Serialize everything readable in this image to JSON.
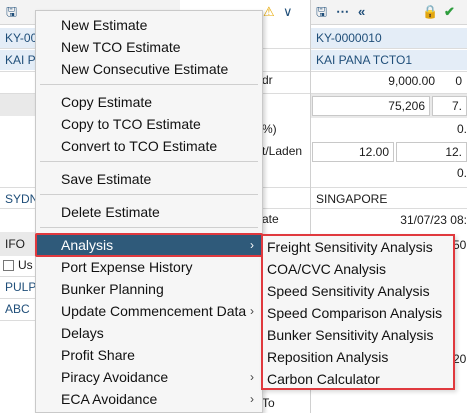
{
  "background": {
    "left_id": "KY-00",
    "left_name": "KAI P",
    "sydney": "SYDN",
    "ifo": "IFO",
    "us": "Us",
    "pulp": "PULP",
    "abc": "ABC",
    "right_id": "KY-0000010",
    "right_name": "KAI PANA TCTO1",
    "label_dr": "dr",
    "label_pct": "%)",
    "label_laden": "t/Laden",
    "label_ate": "ate",
    "label_to": "To",
    "val_9000": "9,000.00",
    "val_0a": "0",
    "val_75206": "75,206",
    "val_7": "7.",
    "val_0b": "0.",
    "val_0c": "0.",
    "val_1200": "12.00",
    "val_12": "12.",
    "port": "SINGAPORE",
    "date": "31/07/23 08:",
    "val_50": "50.",
    "val_20": "20."
  },
  "menu": {
    "items": [
      {
        "label": "New Estimate",
        "has_submenu": false
      },
      {
        "label": "New TCO Estimate",
        "has_submenu": false
      },
      {
        "label": "New Consecutive Estimate",
        "has_submenu": false
      },
      {
        "label": "Copy Estimate",
        "has_submenu": false
      },
      {
        "label": "Copy to TCO Estimate",
        "has_submenu": false
      },
      {
        "label": "Convert to TCO Estimate",
        "has_submenu": false
      },
      {
        "label": "Save Estimate",
        "has_submenu": false
      },
      {
        "label": "Delete Estimate",
        "has_submenu": false
      },
      {
        "label": "Analysis",
        "has_submenu": true,
        "active": true
      },
      {
        "label": "Port Expense History",
        "has_submenu": false
      },
      {
        "label": "Bunker Planning",
        "has_submenu": false
      },
      {
        "label": "Update Commencement Data",
        "has_submenu": true
      },
      {
        "label": "Delays",
        "has_submenu": false
      },
      {
        "label": "Profit Share",
        "has_submenu": false
      },
      {
        "label": "Piracy Avoidance",
        "has_submenu": true
      },
      {
        "label": "ECA Avoidance",
        "has_submenu": true
      }
    ],
    "arrow_glyph": "›"
  },
  "submenu": {
    "items": [
      "Freight Sensitivity Analysis",
      "COA/CVC Analysis",
      "Speed Sensitivity Analysis",
      "Speed Comparison Analysis",
      "Bunker Sensitivity Analysis",
      "Reposition Analysis",
      "Carbon Calculator"
    ]
  },
  "toolbar": {
    "icons": [
      "save-icon",
      "more-icon",
      "collapse-left-icon",
      "lock-icon",
      "warning-icon",
      "check-icon"
    ]
  },
  "colors": {
    "accent": "#1f4e79",
    "active_menu": "#2f5a7a",
    "highlight_border": "#e0393e",
    "lock_green": "#2e9e3e",
    "warning_yellow": "#e6a700"
  }
}
